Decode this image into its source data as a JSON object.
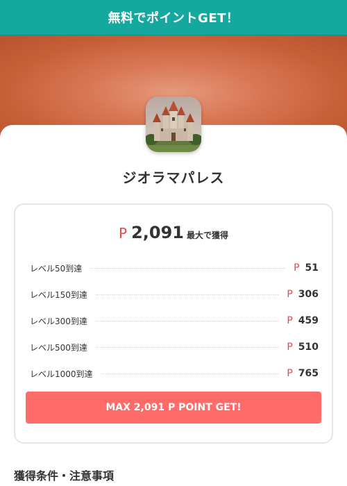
{
  "header": {
    "title": "無料でポイントGET！"
  },
  "app": {
    "name": "ジオラマパレス",
    "icon": "castle-icon"
  },
  "reward": {
    "currency_symbol": "P",
    "total": "2,091",
    "total_suffix": "最大で獲得",
    "rows": [
      {
        "label": "レベル50到達",
        "symbol": "P",
        "value": "51"
      },
      {
        "label": "レベル150到達",
        "symbol": "P",
        "value": "306"
      },
      {
        "label": "レベル300到達",
        "symbol": "P",
        "value": "459"
      },
      {
        "label": "レベル500到達",
        "symbol": "P",
        "value": "510"
      },
      {
        "label": "レベル1000到達",
        "symbol": "P",
        "value": "765"
      }
    ],
    "button_label": "MAX 2,091 P POINT GET!"
  },
  "section": {
    "title": "獲得条件・注意事項"
  },
  "colors": {
    "header_bg": "#14a89e",
    "accent_red": "#e8484f",
    "button_bg": "#ff6b69",
    "hero_bg": "#d97755"
  }
}
